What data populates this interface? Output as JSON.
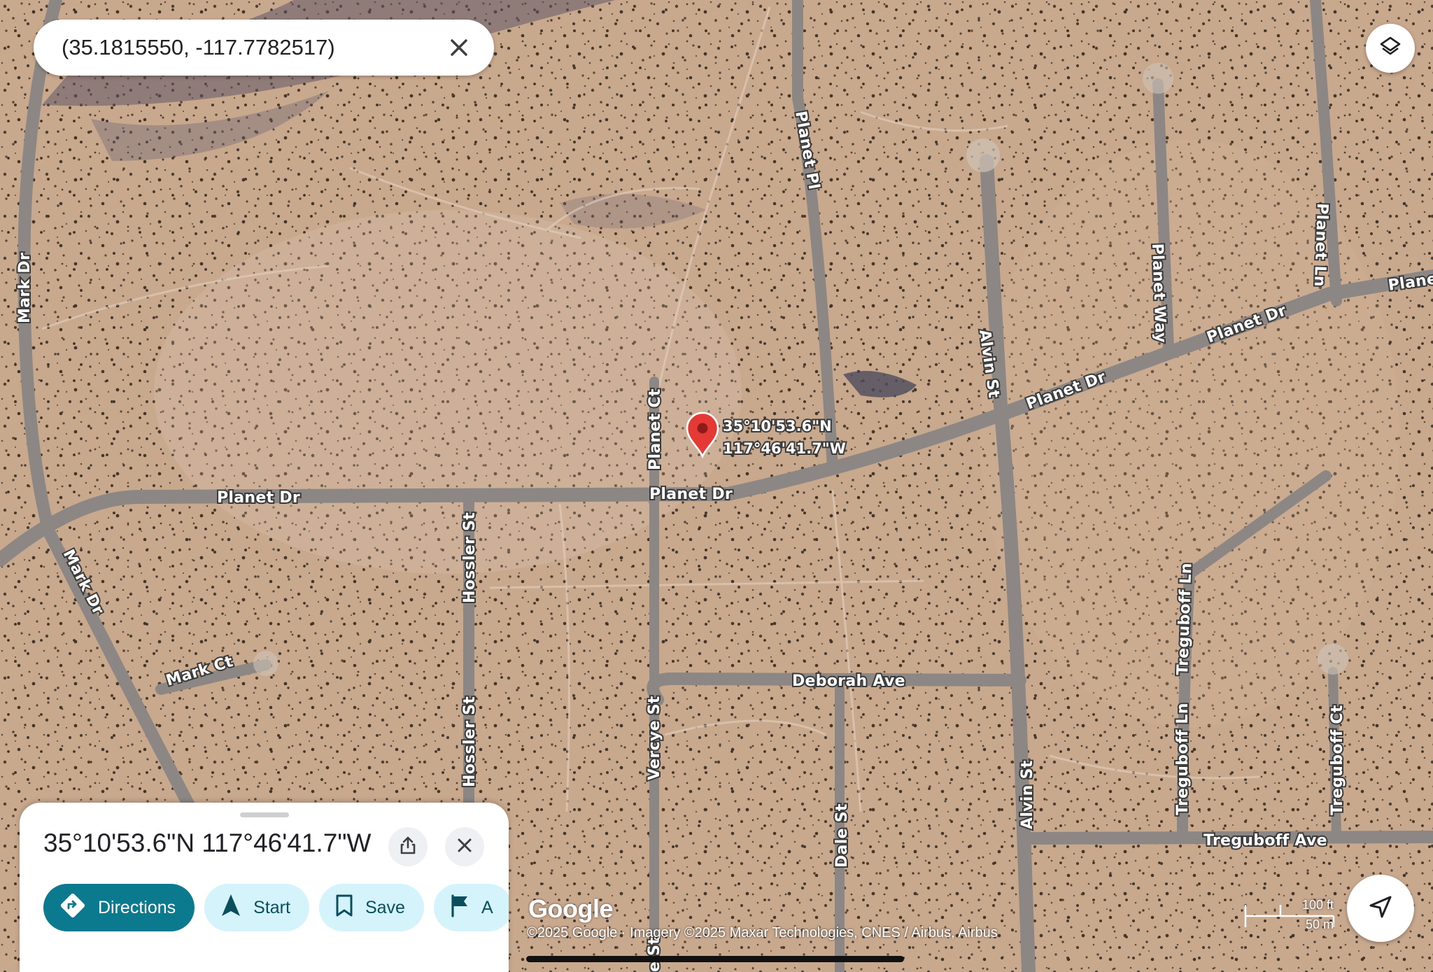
{
  "search": {
    "query": "(35.1815550, -117.7782517)",
    "close_icon": "close-icon"
  },
  "map": {
    "type": "satellite",
    "pin": {
      "lat_label": "35°10'53.6\"N",
      "lng_label": "117°46'41.7\"W",
      "color": "#e53935"
    },
    "road_labels": {
      "planet_dr_west": "Planet Dr",
      "planet_dr_center": "Planet Dr",
      "planet_dr_east1": "Planet Dr",
      "planet_dr_east2": "Planet Dr",
      "planet_dr_edge": "Plane",
      "planet_ct": "Planet Ct",
      "planet_pl": "Planet Pl",
      "planet_way": "Planet Way",
      "planet_ln": "Planet Ln",
      "alvin_st_north": "Alvin St",
      "alvin_st_south": "Alvin St",
      "mark_dr_north": "Mark Dr",
      "mark_dr_south": "Mark Dr",
      "mark_ct": "Mark Ct",
      "hossler_st_north": "Hossler St",
      "hossler_st_south": "Hossler St",
      "vercye_st": "Vercye St",
      "vercye_st_bottom": "e St",
      "deborah_ave": "Deborah Ave",
      "dale_st": "Dale St",
      "treguboff_ln_north": "Treguboff Ln",
      "treguboff_ln_south": "Treguboff Ln",
      "treguboff_ct": "Treguboff Ct",
      "treguboff_ave": "Treguboff Ave"
    },
    "logo": "Google",
    "attribution": "©2025 Google · Imagery ©2025 Maxar Technologies, CNES / Airbus, Airbus",
    "scale": {
      "imperial": "100 ft",
      "metric": "50 m"
    }
  },
  "sheet": {
    "title": "35°10'53.6\"N 117°46'41.7\"W",
    "share_icon": "share-icon",
    "close_icon": "close-icon",
    "actions": [
      {
        "label": "Directions",
        "icon": "directions-icon"
      },
      {
        "label": "Start",
        "icon": "navigation-arrow-icon"
      },
      {
        "label": "Save",
        "icon": "bookmark-icon"
      },
      {
        "label": "A",
        "icon": "flag-icon"
      }
    ]
  },
  "controls": {
    "layers_icon": "layers-icon",
    "locate_icon": "my-location-icon"
  },
  "colors": {
    "primary": "#0b7a8f",
    "chip_secondary": "#d5f3fb",
    "terrain": "#c9a98e",
    "road": "#8c8784"
  }
}
